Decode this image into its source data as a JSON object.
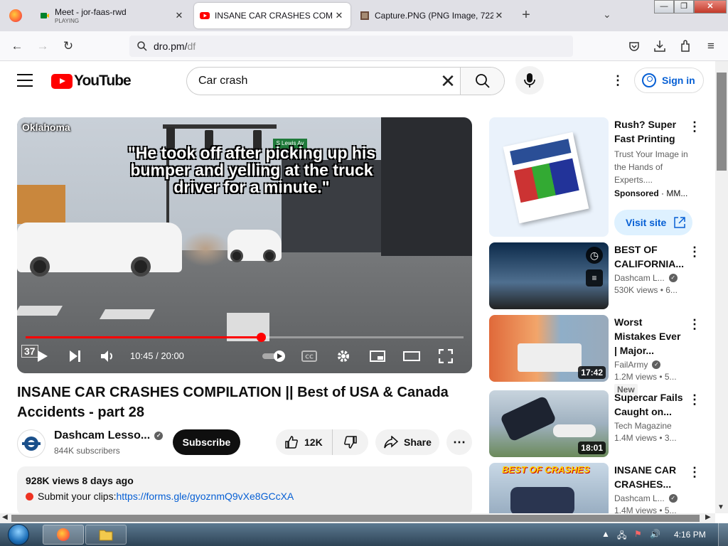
{
  "browser": {
    "tabs": [
      {
        "title": "Meet - jor-faas-rwd",
        "subtitle": "PLAYING"
      },
      {
        "title": "INSANE CAR CRASHES COMPIL"
      },
      {
        "title": "Capture.PNG (PNG Image, 722"
      }
    ],
    "url_domain": "dro.pm/",
    "url_path": "df"
  },
  "youtube": {
    "logo_text": "YouTube",
    "search_query": "Car crash",
    "sign_in": "Sign in"
  },
  "player": {
    "overlay_location": "Oklahoma",
    "overlay_quote": "\"He took off after picking up his bumper and yelling at the truck driver for a minute.\"",
    "street_sign": "S Lewis Av",
    "badge": "37",
    "time_current": "10:45",
    "time_total": "20:00",
    "time_display": "10:45 / 20:00",
    "progress_fraction": 0.5375
  },
  "video": {
    "title": "INSANE CAR CRASHES COMPILATION || Best of USA & Canada Accidents - part 28",
    "channel": "Dashcam Lesso...",
    "subscribers": "844K subscribers",
    "subscribe_label": "Subscribe",
    "likes": "12K",
    "share_label": "Share",
    "views_date": "928K views  8 days ago",
    "desc_prefix": "Submit your clips: ",
    "desc_link": "https://forms.gle/gyoznmQ9vXe8GCcXA"
  },
  "sidebar": {
    "ad": {
      "title": "Rush? Super Fast Printing",
      "desc": "Trust Your Image in the Hands of Experts....",
      "sponsored": "Sponsored",
      "advertiser": "· MM...",
      "cta": "Visit site"
    },
    "items": [
      {
        "title": "BEST OF CALIFORNIA...",
        "channel": "Dashcam L...",
        "meta": "530K views  • 6..."
      },
      {
        "title": "Worst Mistakes Ever | Major...",
        "channel": "FailArmy",
        "meta": "1.2M views  • 5...",
        "duration": "17:42",
        "badge": "New"
      },
      {
        "title": "Supercar Fails Caught on...",
        "channel": "Tech Magazine",
        "meta": "1.4M views  • 3...",
        "duration": "18:01"
      },
      {
        "title": "INSANE CAR CRASHES...",
        "channel": "Dashcam L...",
        "meta": "1.4M views  • 5...",
        "thumb_text": "BEST OF CRASHES"
      }
    ]
  },
  "taskbar": {
    "clock": "4:16 PM"
  }
}
